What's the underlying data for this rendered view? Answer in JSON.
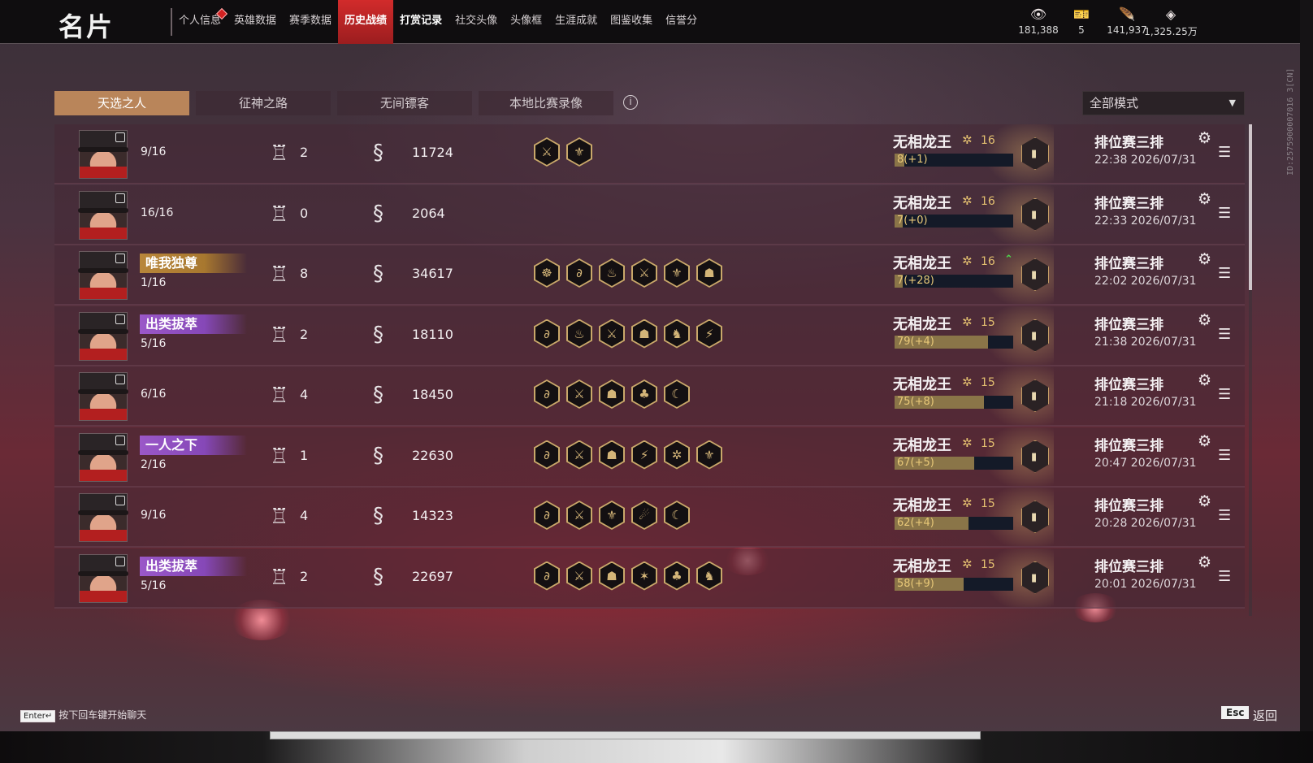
{
  "header": {
    "title": "名片",
    "nav": [
      {
        "label": "个人信息",
        "state": "normal",
        "dot": true
      },
      {
        "label": "英雄数据",
        "state": "normal"
      },
      {
        "label": "赛季数据",
        "state": "normal"
      },
      {
        "label": "历史战绩",
        "state": "active"
      },
      {
        "label": "打赏记录",
        "state": "bold"
      },
      {
        "label": "社交头像",
        "state": "normal"
      },
      {
        "label": "头像框",
        "state": "normal"
      },
      {
        "label": "生涯成就",
        "state": "normal"
      },
      {
        "label": "图鉴收集",
        "state": "normal"
      },
      {
        "label": "信誉分",
        "state": "normal"
      }
    ],
    "currencies": [
      {
        "icon": "eye-currency-icon",
        "glyph": "👁",
        "value": "181,388"
      },
      {
        "icon": "ticket-icon",
        "glyph": "🎫",
        "value": "5"
      },
      {
        "icon": "feather-icon",
        "glyph": "🪶",
        "value": "141,937"
      },
      {
        "icon": "diamond-icon",
        "glyph": "◈",
        "value": "1,325.25万"
      }
    ]
  },
  "side_id": "ID:2575900007016 3[CN]",
  "tabs": [
    "天选之人",
    "征神之路",
    "无间镖客",
    "本地比赛录像"
  ],
  "mode_select": {
    "value": "全部模式"
  },
  "matches": [
    {
      "title": null,
      "placement": "9/16",
      "level": "2",
      "coins": "11724",
      "traits": [
        "⚔",
        "⚜"
      ],
      "rank_name": "无相龙王",
      "rank_num": "16",
      "rank_up": false,
      "progress_text": "8(+1)",
      "progress": 0.08,
      "mode": "排位赛三排",
      "time": "22:38 2026/07/31"
    },
    {
      "title": null,
      "placement": "16/16",
      "level": "0",
      "coins": "2064",
      "traits": [],
      "rank_name": "无相龙王",
      "rank_num": "16",
      "rank_up": false,
      "progress_text": "7(+0)",
      "progress": 0.07,
      "mode": "排位赛三排",
      "time": "22:33 2026/07/31"
    },
    {
      "title": {
        "text": "唯我独尊",
        "color": "gold"
      },
      "placement": "1/16",
      "level": "8",
      "coins": "34617",
      "traits": [
        "☸",
        "∂",
        "♨",
        "⚔",
        "⚜",
        "☗"
      ],
      "rank_name": "无相龙王",
      "rank_num": "16",
      "rank_up": true,
      "progress_text": "7(+28)",
      "progress": 0.07,
      "mode": "排位赛三排",
      "time": "22:02 2026/07/31"
    },
    {
      "title": {
        "text": "出类拔萃",
        "color": "purple"
      },
      "placement": "5/16",
      "level": "2",
      "coins": "18110",
      "traits": [
        "∂",
        "♨",
        "⚔",
        "☗",
        "♞",
        "⚡"
      ],
      "rank_name": "无相龙王",
      "rank_num": "15",
      "rank_up": false,
      "progress_text": "79(+4)",
      "progress": 0.79,
      "mode": "排位赛三排",
      "time": "21:38 2026/07/31"
    },
    {
      "title": null,
      "placement": "6/16",
      "level": "4",
      "coins": "18450",
      "traits": [
        "∂",
        "⚔",
        "☗",
        "♣",
        "☾"
      ],
      "rank_name": "无相龙王",
      "rank_num": "15",
      "rank_up": false,
      "progress_text": "75(+8)",
      "progress": 0.75,
      "mode": "排位赛三排",
      "time": "21:18 2026/07/31"
    },
    {
      "title": {
        "text": "一人之下",
        "color": "purple"
      },
      "placement": "2/16",
      "level": "1",
      "coins": "22630",
      "traits": [
        "∂",
        "⚔",
        "☗",
        "⚡",
        "✲",
        "⚜"
      ],
      "rank_name": "无相龙王",
      "rank_num": "15",
      "rank_up": false,
      "progress_text": "67(+5)",
      "progress": 0.67,
      "mode": "排位赛三排",
      "time": "20:47 2026/07/31"
    },
    {
      "title": null,
      "placement": "9/16",
      "level": "4",
      "coins": "14323",
      "traits": [
        "∂",
        "⚔",
        "⚜",
        "☄",
        "☾"
      ],
      "rank_name": "无相龙王",
      "rank_num": "15",
      "rank_up": false,
      "progress_text": "62(+4)",
      "progress": 0.62,
      "mode": "排位赛三排",
      "time": "20:28 2026/07/31"
    },
    {
      "title": {
        "text": "出类拔萃",
        "color": "purple"
      },
      "placement": "5/16",
      "level": "2",
      "coins": "22697",
      "traits": [
        "∂",
        "⚔",
        "☗",
        "✶",
        "♣",
        "♞"
      ],
      "rank_name": "无相龙王",
      "rank_num": "15",
      "rank_up": false,
      "progress_text": "58(+9)",
      "progress": 0.58,
      "mode": "排位赛三排",
      "time": "20:01 2026/07/31"
    }
  ],
  "footer": {
    "enter_key": "Enter↵",
    "hint": "按下回车键开始聊天",
    "esc_key": "Esc",
    "back": "返回"
  }
}
